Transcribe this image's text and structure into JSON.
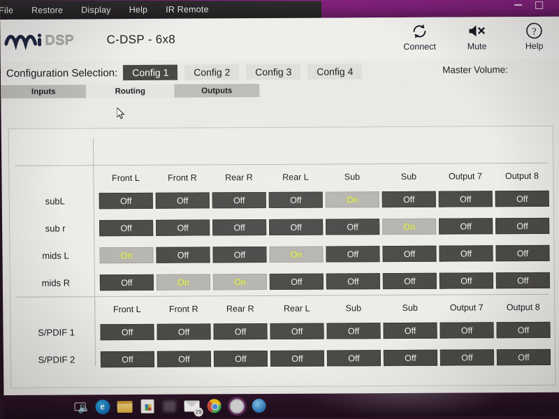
{
  "window": {
    "titlebar_color": "#7a1a74",
    "minimize_label": "Minimize",
    "maximize_label": "Maximize"
  },
  "menubar": {
    "items": [
      {
        "label": "File"
      },
      {
        "label": "Restore"
      },
      {
        "label": "Display"
      },
      {
        "label": "Help"
      },
      {
        "label": "IR Remote"
      }
    ]
  },
  "header": {
    "brand": "miniDSP",
    "brand_mini": "mini",
    "brand_dsp": "DSP",
    "device_title": "C-DSP - 6x8",
    "actions": [
      {
        "label": "Connect",
        "icon": "refresh-icon"
      },
      {
        "label": "Mute",
        "icon": "speaker-mute-icon"
      },
      {
        "label": "Help",
        "icon": "question-circle-icon"
      }
    ]
  },
  "config": {
    "label": "Configuration Selection:",
    "buttons": [
      {
        "label": "Config 1",
        "active": true
      },
      {
        "label": "Config 2",
        "active": false
      },
      {
        "label": "Config 3",
        "active": false
      },
      {
        "label": "Config 4",
        "active": false
      }
    ],
    "master_volume_label": "Master Volume:"
  },
  "tabs": [
    {
      "label": "Inputs",
      "active": false
    },
    {
      "label": "Routing",
      "active": true
    },
    {
      "label": "Outputs",
      "active": false
    }
  ],
  "matrix_main": {
    "columns": [
      "Front L",
      "Front R",
      "Rear R",
      "Rear L",
      "Sub",
      "Sub",
      "Output 7",
      "Output 8"
    ],
    "rows": [
      {
        "label": "subL",
        "cells": [
          "Off",
          "Off",
          "Off",
          "Off",
          "On",
          "Off",
          "Off",
          "Off"
        ]
      },
      {
        "label": "sub r",
        "cells": [
          "Off",
          "Off",
          "Off",
          "Off",
          "Off",
          "On",
          "Off",
          "Off"
        ]
      },
      {
        "label": "mids L",
        "cells": [
          "On",
          "Off",
          "Off",
          "On",
          "Off",
          "Off",
          "Off",
          "Off"
        ]
      },
      {
        "label": "mids R",
        "cells": [
          "Off",
          "On",
          "On",
          "Off",
          "Off",
          "Off",
          "Off",
          "Off"
        ]
      }
    ]
  },
  "matrix_spdif": {
    "columns": [
      "Front L",
      "Front R",
      "Rear R",
      "Rear L",
      "Sub",
      "Sub",
      "Output 7",
      "Output 8"
    ],
    "rows": [
      {
        "label": "S/PDIF 1",
        "cells": [
          "Off",
          "Off",
          "Off",
          "Off",
          "Off",
          "Off",
          "Off",
          "Off"
        ]
      },
      {
        "label": "S/PDIF 2",
        "cells": [
          "Off",
          "Off",
          "Off",
          "Off",
          "Off",
          "Off",
          "Off",
          "Off"
        ]
      }
    ]
  },
  "colors": {
    "cell_off_bg": "#4a4845",
    "cell_off_text": "#f4f4f4",
    "cell_on_bg": "#b8b7b1",
    "cell_on_text": "#e9f542",
    "config_active_bg": "#474541",
    "titlebar": "#7a1a74"
  },
  "taskbar": {
    "items": [
      {
        "name": "cortana-mic-icon"
      },
      {
        "name": "task-view-icon"
      },
      {
        "name": "edge-browser-icon"
      },
      {
        "name": "file-explorer-icon"
      },
      {
        "name": "microsoft-store-icon"
      },
      {
        "name": "unknown-app-icon"
      },
      {
        "name": "mail-icon",
        "badge": "29"
      },
      {
        "name": "chrome-browser-icon"
      },
      {
        "name": "opera-browser-icon"
      },
      {
        "name": "blue-app-icon"
      }
    ]
  }
}
